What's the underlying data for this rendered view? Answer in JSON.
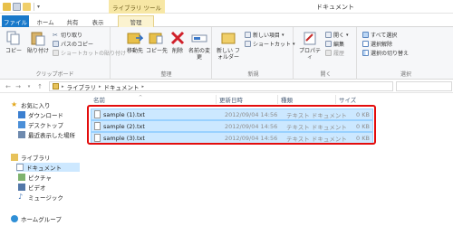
{
  "titlebar": {
    "context_tab_label": "ライブラリ ツール",
    "window_title": "ドキュメント"
  },
  "tabs": [
    {
      "label": "ファイル"
    },
    {
      "label": "ホーム"
    },
    {
      "label": "共有"
    },
    {
      "label": "表示"
    },
    {
      "label": "管理"
    }
  ],
  "ribbon": {
    "clipboard": {
      "name": "クリップボード",
      "copy": "コピー",
      "paste": "貼り付け",
      "cut": "切り取り",
      "copy_path": "パスのコピー",
      "paste_shortcut": "ショートカットの貼り付け"
    },
    "organize": {
      "name": "整理",
      "move_to": "移動先",
      "copy_to": "コピー先",
      "delete": "削除",
      "rename": "名前の変更"
    },
    "new": {
      "name": "新規",
      "new_folder": "新しい フォルダー",
      "new_item": "新しい項目",
      "shortcut": "ショートカット"
    },
    "open": {
      "name": "開く",
      "properties": "プロパティ",
      "open": "開く",
      "edit": "編集",
      "history": "履歴"
    },
    "select": {
      "name": "選択",
      "select_all": "すべて選択",
      "select_none": "選択解除",
      "invert": "選択の切り替え"
    }
  },
  "address": {
    "path": [
      "ライブラリ",
      "ドキュメント"
    ],
    "separator": "▸"
  },
  "nav": {
    "favorites": "お気に入り",
    "download": "ダウンロード",
    "desktop": "デスクトップ",
    "recent": "最近表示した場所",
    "libraries": "ライブラリ",
    "documents": "ドキュメント",
    "pictures": "ピクチャ",
    "videos": "ビデオ",
    "music": "ミュージック",
    "homegroup": "ホームグループ"
  },
  "columns": {
    "name": "名前",
    "date": "更新日時",
    "type": "種類",
    "size": "サイズ"
  },
  "files": [
    {
      "name": "sample (1).txt",
      "date": "2012/09/04 14:56",
      "type": "テキスト ドキュメント",
      "size": "0 KB"
    },
    {
      "name": "sample (2).txt",
      "date": "2012/09/04 14:56",
      "type": "テキスト ドキュメント",
      "size": "0 KB"
    },
    {
      "name": "sample (3).txt",
      "date": "2012/09/04 14:56",
      "type": "テキスト ドキュメント",
      "size": "0 KB"
    }
  ],
  "colors": {
    "file_tab": "#1979ca",
    "selection_fill": "#cce8ff",
    "selection_border": "#99d1ff",
    "highlight": "#e30d0d",
    "context_tab": "#f7e7a5"
  }
}
